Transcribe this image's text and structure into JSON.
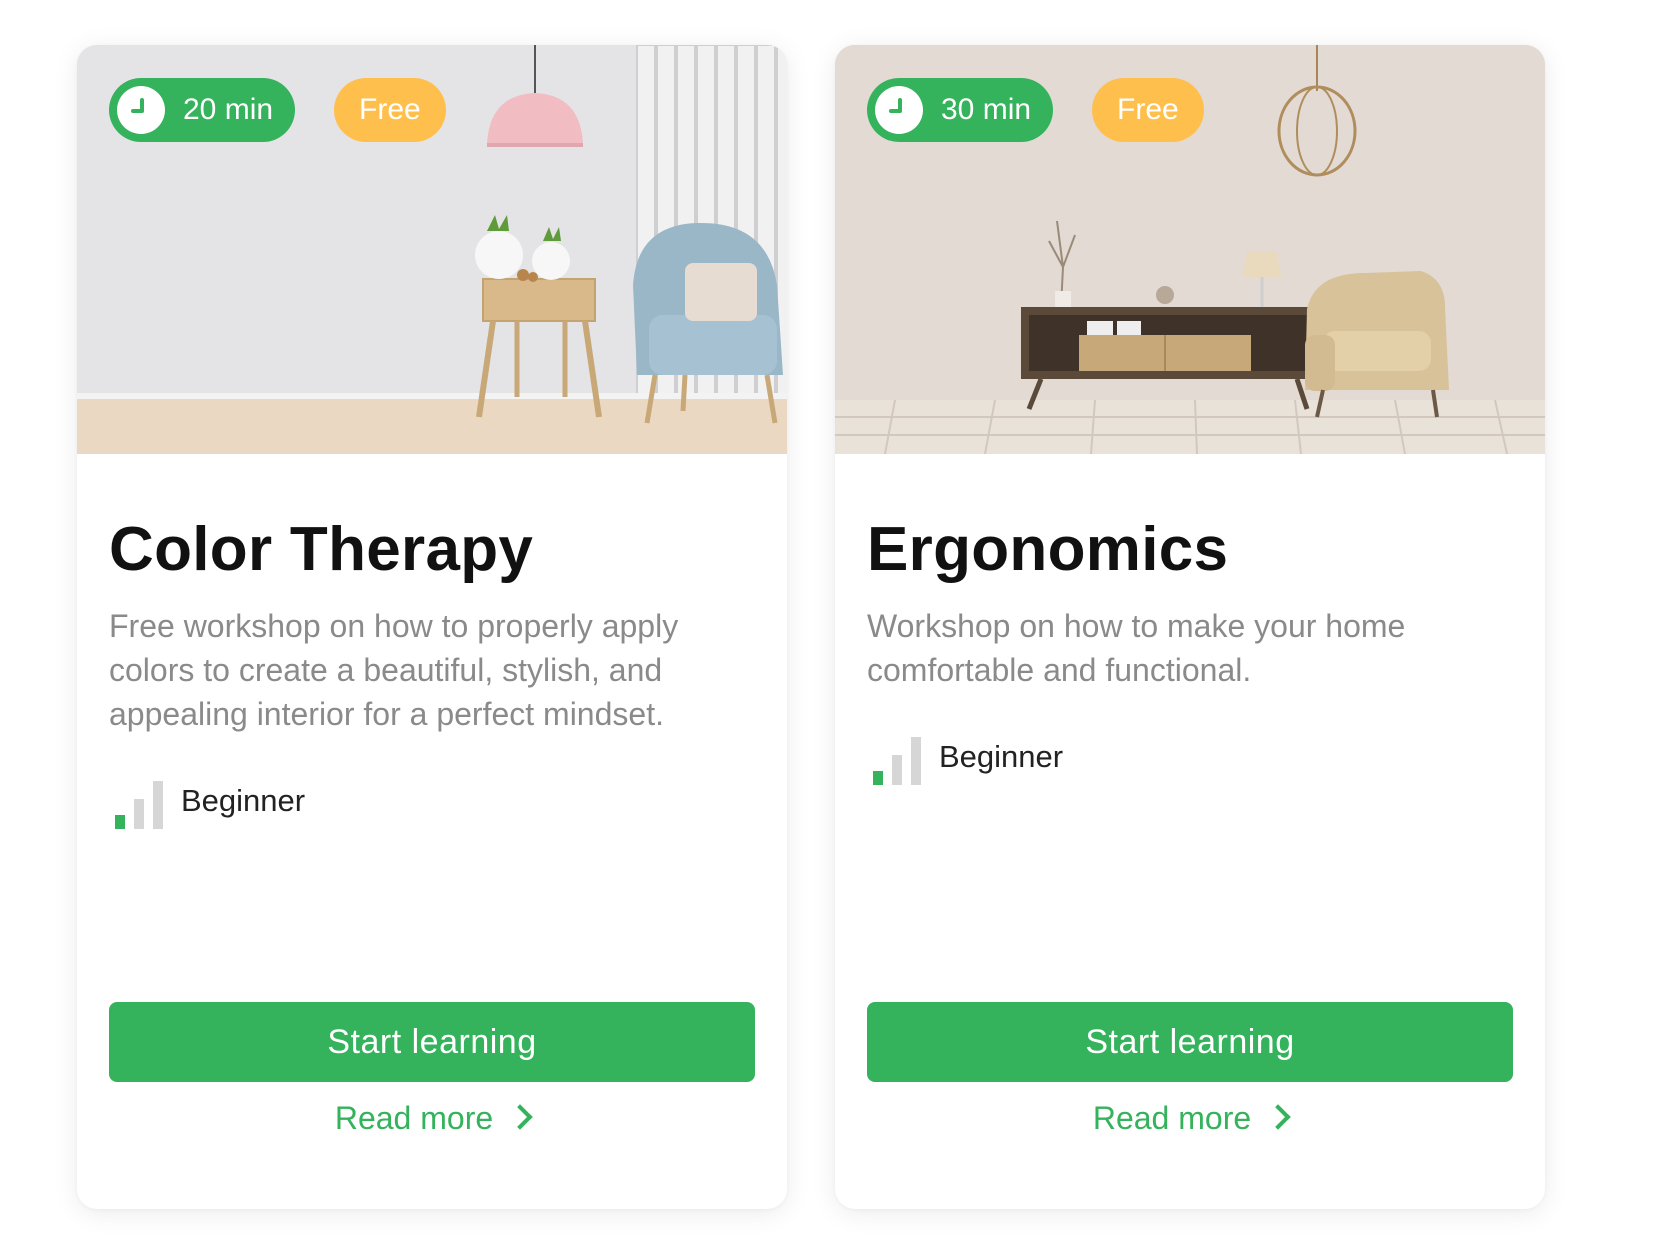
{
  "colors": {
    "accent": "#34b35c",
    "free_badge": "#ffbf4d",
    "title": "#111111",
    "description": "#8a8a8a"
  },
  "cards": [
    {
      "duration": "20 min",
      "price_badge": "Free",
      "title": "Color Therapy",
      "description": "Free workshop on how to properly apply colors to create a beautiful, stylish, and appealing interior for a perfect mindset.",
      "level": "Beginner",
      "level_bars_filled": 1,
      "level_bars_total": 3,
      "cta": "Start learning",
      "read_more": "Read more",
      "image_icon": "living-room-pink-lamp-blue-armchair"
    },
    {
      "duration": "30 min",
      "price_badge": "Free",
      "title": "Ergonomics",
      "description": "Workshop on how to make your home comfortable and functional.",
      "level": "Beginner",
      "level_bars_filled": 1,
      "level_bars_total": 3,
      "cta": "Start learning",
      "read_more": "Read more",
      "image_icon": "living-room-wood-sideboard-beige-armchair"
    }
  ]
}
